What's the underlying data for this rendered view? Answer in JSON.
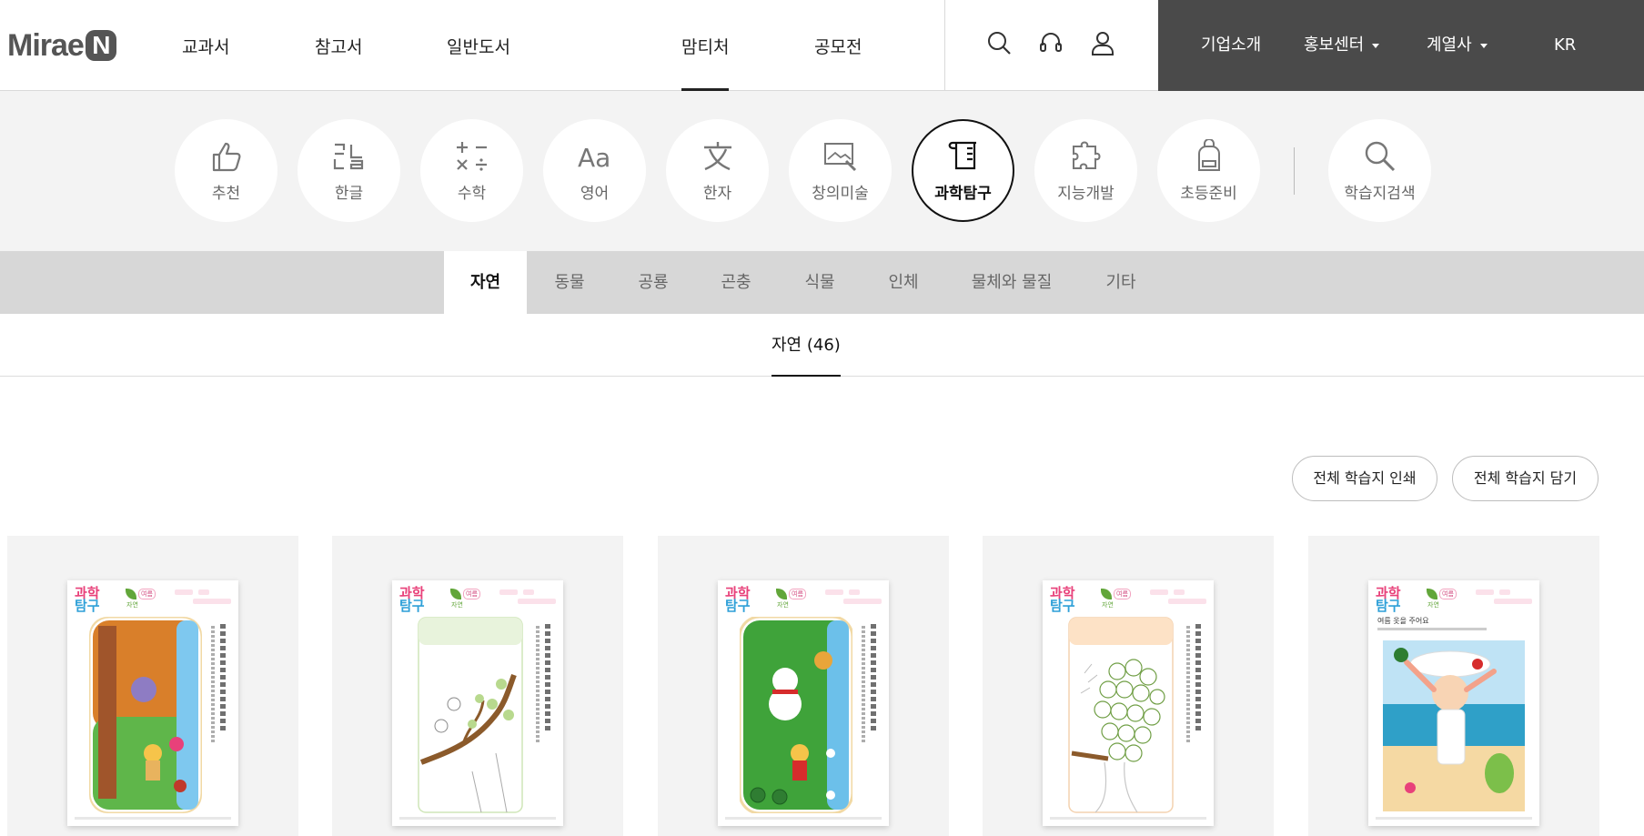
{
  "header": {
    "logo_text": "Mirae",
    "logo_mark": "N",
    "gnb": [
      "교과서",
      "참고서",
      "일반도서",
      "맘티처",
      "공모전"
    ],
    "gnb_active": "맘티처",
    "util_icons": [
      "search-icon",
      "headset-icon",
      "user-icon"
    ],
    "corp_menu": [
      {
        "label": "기업소개",
        "has_dropdown": false
      },
      {
        "label": "홍보센터",
        "has_dropdown": true
      },
      {
        "label": "계열사",
        "has_dropdown": true
      },
      {
        "label": "KR",
        "has_dropdown": false
      }
    ]
  },
  "categories": {
    "items": [
      {
        "label": "추천",
        "icon": "thumbs-up-icon"
      },
      {
        "label": "한글",
        "icon": "hangul-icon"
      },
      {
        "label": "수학",
        "icon": "math-operators-icon"
      },
      {
        "label": "영어",
        "icon": "aa-icon"
      },
      {
        "label": "한자",
        "icon": "hanja-icon"
      },
      {
        "label": "창의미술",
        "icon": "drawing-icon"
      },
      {
        "label": "과학탐구",
        "icon": "beaker-icon"
      },
      {
        "label": "지능개발",
        "icon": "puzzle-icon"
      },
      {
        "label": "초등준비",
        "icon": "backpack-icon"
      }
    ],
    "search": {
      "label": "학습지검색",
      "icon": "search-icon"
    },
    "active": "과학탐구"
  },
  "subtabs": {
    "items": [
      "자연",
      "동물",
      "공룡",
      "곤충",
      "식물",
      "인체",
      "물체와 물질",
      "기타"
    ],
    "active": "자연"
  },
  "count_tab": {
    "label": "자연 (46)"
  },
  "actions": {
    "print_all": "전체 학습지 인쇄",
    "save_all": "전체 학습지 담기"
  },
  "cards": [
    {
      "brand_top": "과학",
      "brand_bottom": "탐구",
      "subtitle": "자연",
      "tag": "여름"
    },
    {
      "brand_top": "과학",
      "brand_bottom": "탐구",
      "subtitle": "자연",
      "tag": "여름"
    },
    {
      "brand_top": "과학",
      "brand_bottom": "탐구",
      "subtitle": "자연",
      "tag": "여름"
    },
    {
      "brand_top": "과학",
      "brand_bottom": "탐구",
      "subtitle": "자연",
      "tag": "여름"
    },
    {
      "brand_top": "과학",
      "brand_bottom": "탐구",
      "subtitle": "자연",
      "tag": "여름",
      "heading": "여름 옷을 주어요"
    }
  ],
  "colors": {
    "corp_bar": "#4a4a4a",
    "cat_band": "#f3f3f3",
    "subtab_bar": "#d7d7d7",
    "accent_pink": "#e8417a",
    "accent_blue": "#2fa0d8"
  }
}
